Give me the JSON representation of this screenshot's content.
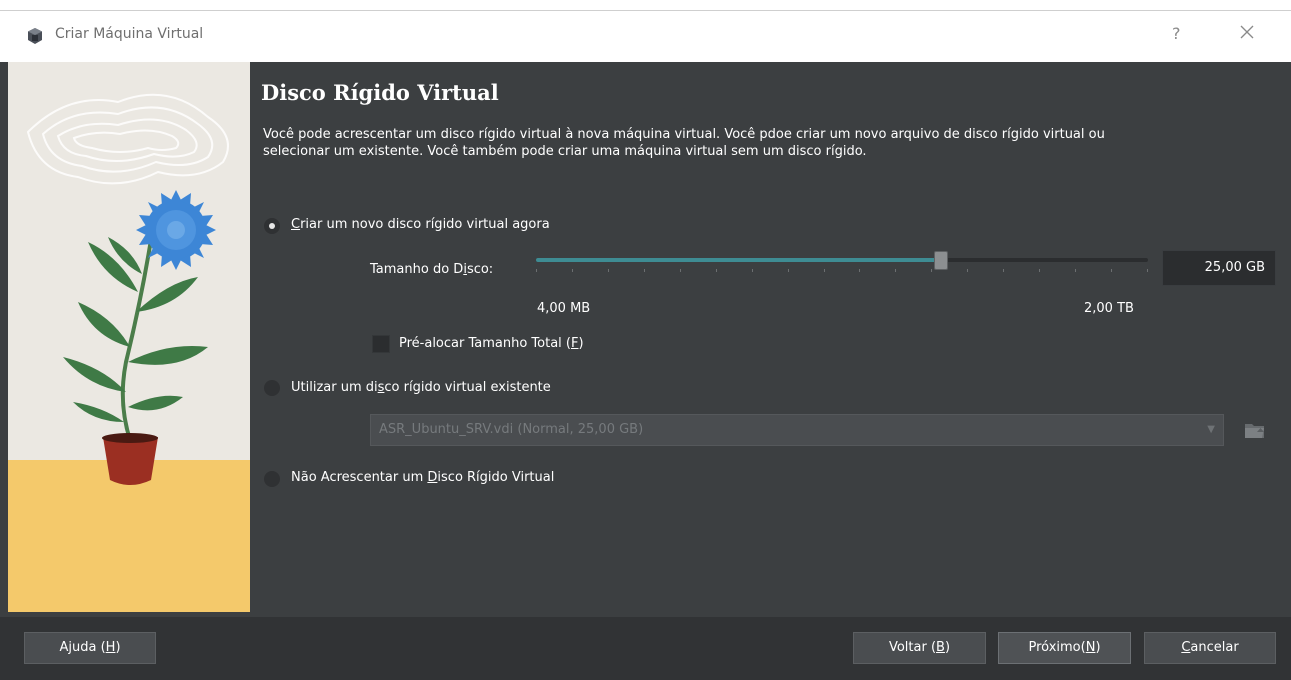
{
  "window": {
    "title": "Criar Máquina Virtual",
    "help": "?"
  },
  "page": {
    "heading": "Disco Rígido Virtual",
    "description": "Você pode acrescentar um disco rígido virtual à nova máquina virtual. Você pdoe criar um novo arquivo de disco rígido virtual ou selecionar um existente. Você também pode criar uma máquina virtual sem um disco rígido."
  },
  "option_new": {
    "mnemonic": "C",
    "rest": "riar um novo disco rígido virtual agora",
    "selected": true
  },
  "disk_size": {
    "label_a": "Tamanho do D",
    "label_mnemonic": "i",
    "label_b": "sco:",
    "value_text": "25,00 GB",
    "min_label": "4,00 MB",
    "max_label": "2,00 TB",
    "slider_fraction": 0.66
  },
  "prealloc": {
    "label_a": "Pré-alocar Tamanho Total (",
    "mnemonic": "F",
    "label_b": ")",
    "checked": false
  },
  "option_existing": {
    "label_a": "Utilizar um di",
    "mnemonic": "s",
    "label_b": "co rígido virtual existente",
    "selected": false,
    "combo_value": "ASR_Ubuntu_SRV.vdi (Normal, 25,00 GB)"
  },
  "option_none": {
    "label_a": "Não Acrescentar um ",
    "mnemonic": "D",
    "label_b": "isco Rígido Virtual",
    "selected": false
  },
  "buttons": {
    "help_a": "Ajuda (",
    "help_m": "H",
    "help_b": ")",
    "back_a": "Voltar (",
    "back_m": "B",
    "back_b": ")",
    "next_a": "Próximo(",
    "next_m": "N",
    "next_b": ")",
    "cancel_m": "C",
    "cancel_b": "ancelar"
  },
  "colors": {
    "accent": "#3e8c93",
    "background": "#3c3f41",
    "footer": "#313335"
  }
}
